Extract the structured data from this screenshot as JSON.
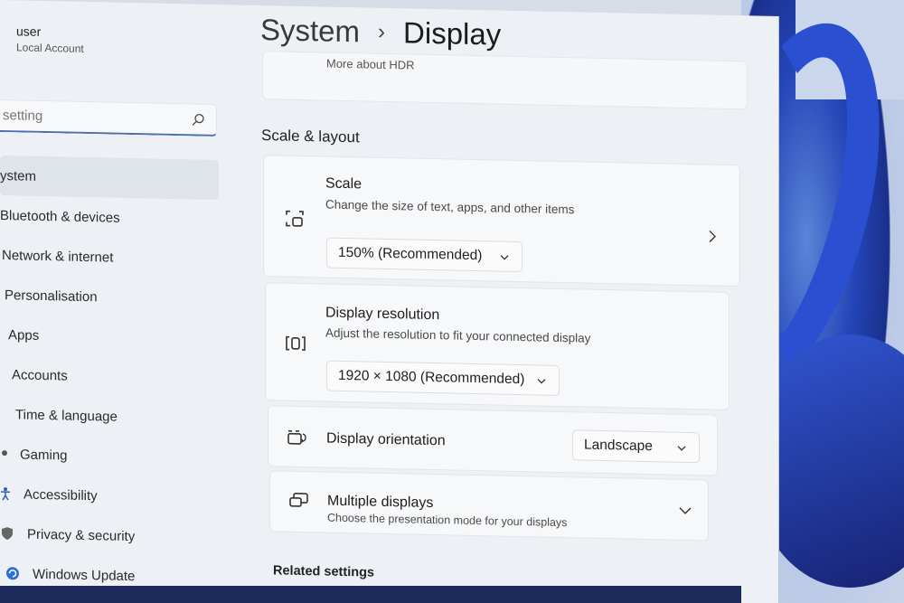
{
  "account": {
    "name": "user",
    "type": "Local Account"
  },
  "search": {
    "value": "setting"
  },
  "sidebar": {
    "items": [
      {
        "label": "ystem",
        "icon": "system-icon",
        "active": true
      },
      {
        "label": "Bluetooth & devices",
        "icon": "bluetooth-icon"
      },
      {
        "label": "Network & internet",
        "icon": "wifi-icon"
      },
      {
        "label": "Personalisation",
        "icon": "brush-icon"
      },
      {
        "label": "Apps",
        "icon": "apps-icon"
      },
      {
        "label": "Accounts",
        "icon": "person-icon"
      },
      {
        "label": "Time & language",
        "icon": "clock-icon"
      },
      {
        "label": "Gaming",
        "icon": "gamepad-icon"
      },
      {
        "label": "Accessibility",
        "icon": "accessibility-icon"
      },
      {
        "label": "Privacy & security",
        "icon": "shield-icon"
      },
      {
        "label": "Windows Update",
        "icon": "update-icon"
      }
    ]
  },
  "breadcrumb": {
    "parent": "System",
    "separator": "›",
    "current": "Display"
  },
  "hdr": {
    "link_text": "More about HDR"
  },
  "scale_layout": {
    "section_title": "Scale & layout",
    "scale": {
      "title": "Scale",
      "desc": "Change the size of text, apps, and other items",
      "value": "150% (Recommended)"
    },
    "resolution": {
      "title": "Display resolution",
      "desc": "Adjust the resolution to fit your connected display",
      "value": "1920 × 1080 (Recommended)"
    },
    "orientation": {
      "title": "Display orientation",
      "value": "Landscape"
    },
    "multiple": {
      "title": "Multiple displays",
      "desc": "Choose the presentation mode for your displays"
    }
  },
  "related": {
    "title": "Related settings"
  },
  "colors": {
    "accent": "#4d6ea8",
    "window_bg": "#edf0f5",
    "card_bg": "#f7f8fa"
  }
}
